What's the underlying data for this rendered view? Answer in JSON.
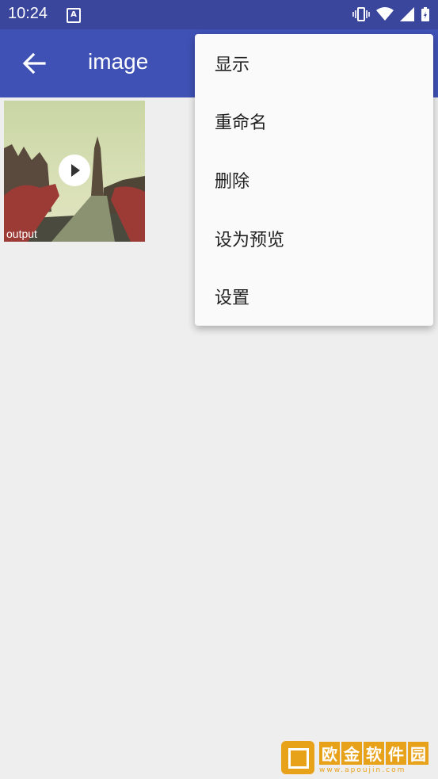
{
  "status_bar": {
    "time": "10:24",
    "notification_icon": "A"
  },
  "app_bar": {
    "title": "image"
  },
  "media": [
    {
      "label": "output"
    }
  ],
  "menu": {
    "items": [
      {
        "label": "显示"
      },
      {
        "label": "重命名"
      },
      {
        "label": "删除"
      },
      {
        "label": "设为预览"
      },
      {
        "label": "设置"
      }
    ]
  },
  "watermark": {
    "chars": [
      "欧",
      "金",
      "软",
      "件",
      "园"
    ],
    "url": "www.apoujin.com"
  },
  "colors": {
    "status_bar": "#3a459c",
    "app_bar": "#3f51b5",
    "background": "#eeeeee",
    "menu": "#fafafa",
    "watermark": "#e8a21a"
  }
}
